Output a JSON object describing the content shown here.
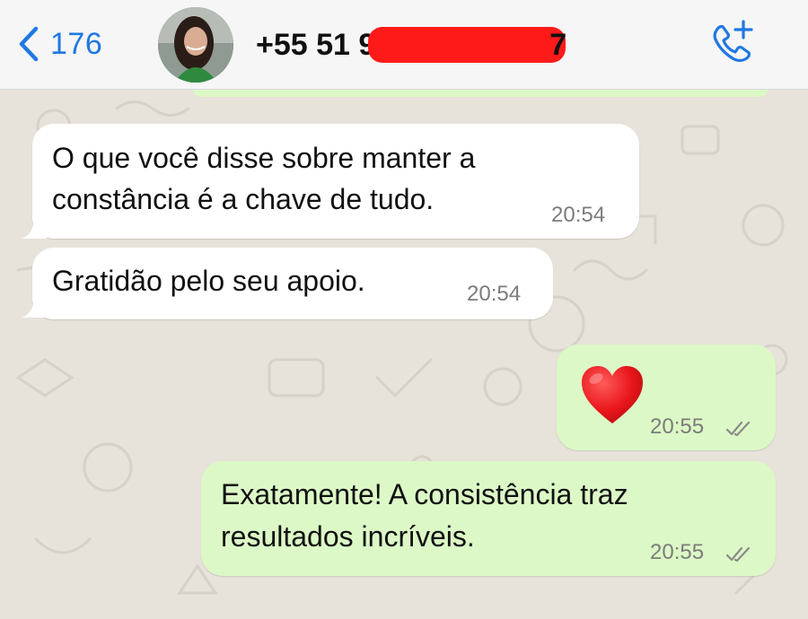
{
  "header": {
    "back_count": "176",
    "contact_prefix": "+55 51 9",
    "contact_suffix": "7",
    "icons": {
      "back": "chevron-left-icon",
      "call_add": "phone-plus-icon"
    }
  },
  "colors": {
    "accent": "#1f78e3",
    "incoming_bubble": "#ffffff",
    "outgoing_bubble": "#dcf8c6",
    "wallpaper": "#e7e2da",
    "redaction": "#ff1a1a"
  },
  "messages": [
    {
      "direction": "incoming",
      "lines": [
        "O que você disse sobre manter a",
        "constância é a chave de tudo."
      ],
      "time": "20:54"
    },
    {
      "direction": "incoming",
      "lines": [
        "Gratidão pelo seu apoio."
      ],
      "time": "20:54"
    },
    {
      "direction": "outgoing",
      "emoji": "❤️",
      "time": "20:55",
      "status": "read"
    },
    {
      "direction": "outgoing",
      "lines": [
        "Exatamente! A consistência traz",
        "resultados incríveis."
      ],
      "time": "20:55",
      "status": "read"
    }
  ]
}
